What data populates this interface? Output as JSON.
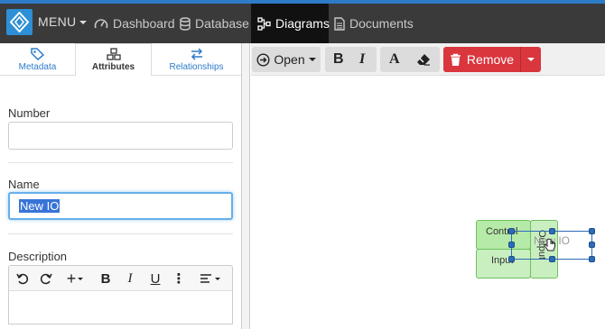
{
  "navbar": {
    "menu_label": "MENU",
    "items": [
      {
        "label": "Dashboard",
        "icon": "dashboard-icon",
        "active": false
      },
      {
        "label": "Database",
        "icon": "database-icon",
        "active": false
      },
      {
        "label": "Diagrams",
        "icon": "diagram-icon",
        "active": true
      },
      {
        "label": "Documents",
        "icon": "document-icon",
        "active": false
      }
    ],
    "accent_color": "#2d7cc8"
  },
  "left_panel": {
    "tabs": [
      {
        "label": "Metadata",
        "icon": "tag-icon",
        "active": false
      },
      {
        "label": "Attributes",
        "icon": "attributes-icon",
        "active": true
      },
      {
        "label": "Relationships",
        "icon": "arrows-exchange-icon",
        "active": false
      }
    ],
    "fields": {
      "number_label": "Number",
      "number_value": "",
      "name_label": "Name",
      "name_value": "New IO",
      "description_label": "Description"
    },
    "editor_toolbar": {
      "undo_icon": "undo-icon",
      "redo_icon": "redo-icon",
      "insert_label": "+",
      "bold_label": "B",
      "italic_label": "I",
      "underline_label": "U",
      "more_label": "⋮",
      "align_icon": "align-left-icon"
    }
  },
  "canvas_toolbar": {
    "open_label": "Open",
    "bold_label": "B",
    "italic_label": "I",
    "font_color_label": "A",
    "eraser_icon": "eraser-icon",
    "remove_label": "Remove",
    "remove_color": "#d9363e"
  },
  "diagram": {
    "labels": {
      "control": "Control",
      "input": "Input",
      "output": "Output",
      "new_io": "New IO"
    },
    "shape_color": "#c9efc0",
    "selection_color": "#2d6bb8"
  }
}
